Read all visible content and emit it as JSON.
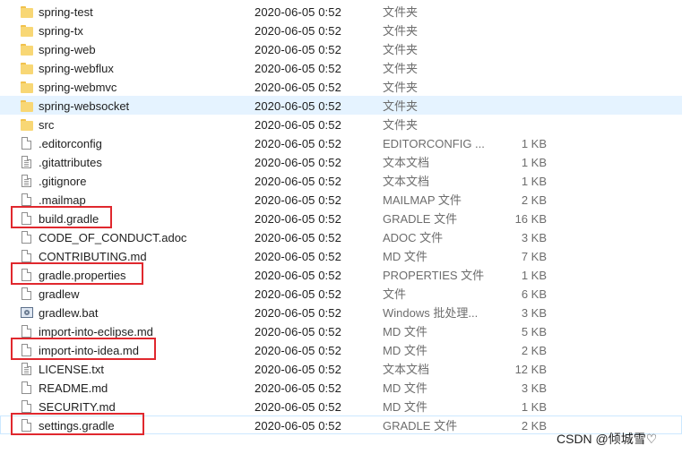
{
  "files": [
    {
      "name": "spring-test",
      "date": "2020-06-05  0:52",
      "type": "文件夹",
      "size": "",
      "icon": "folder-icon"
    },
    {
      "name": "spring-tx",
      "date": "2020-06-05  0:52",
      "type": "文件夹",
      "size": "",
      "icon": "folder-icon"
    },
    {
      "name": "spring-web",
      "date": "2020-06-05  0:52",
      "type": "文件夹",
      "size": "",
      "icon": "folder-icon"
    },
    {
      "name": "spring-webflux",
      "date": "2020-06-05  0:52",
      "type": "文件夹",
      "size": "",
      "icon": "folder-icon"
    },
    {
      "name": "spring-webmvc",
      "date": "2020-06-05  0:52",
      "type": "文件夹",
      "size": "",
      "icon": "folder-icon"
    },
    {
      "name": "spring-websocket",
      "date": "2020-06-05  0:52",
      "type": "文件夹",
      "size": "",
      "icon": "folder-icon",
      "state": "hover"
    },
    {
      "name": "src",
      "date": "2020-06-05  0:52",
      "type": "文件夹",
      "size": "",
      "icon": "folder-icon"
    },
    {
      "name": ".editorconfig",
      "date": "2020-06-05  0:52",
      "type": "EDITORCONFIG ...",
      "size": "1 KB",
      "icon": "file-icon"
    },
    {
      "name": ".gitattributes",
      "date": "2020-06-05  0:52",
      "type": "文本文档",
      "size": "1 KB",
      "icon": "text-file-icon"
    },
    {
      "name": ".gitignore",
      "date": "2020-06-05  0:52",
      "type": "文本文档",
      "size": "1 KB",
      "icon": "text-file-icon"
    },
    {
      "name": ".mailmap",
      "date": "2020-06-05  0:52",
      "type": "MAILMAP 文件",
      "size": "2 KB",
      "icon": "file-icon"
    },
    {
      "name": "build.gradle",
      "date": "2020-06-05  0:52",
      "type": "GRADLE 文件",
      "size": "16 KB",
      "icon": "file-icon",
      "highlight": true
    },
    {
      "name": "CODE_OF_CONDUCT.adoc",
      "date": "2020-06-05  0:52",
      "type": "ADOC 文件",
      "size": "3 KB",
      "icon": "file-icon"
    },
    {
      "name": "CONTRIBUTING.md",
      "date": "2020-06-05  0:52",
      "type": "MD 文件",
      "size": "7 KB",
      "icon": "file-icon"
    },
    {
      "name": "gradle.properties",
      "date": "2020-06-05  0:52",
      "type": "PROPERTIES 文件",
      "size": "1 KB",
      "icon": "file-icon",
      "highlight": true
    },
    {
      "name": "gradlew",
      "date": "2020-06-05  0:52",
      "type": "文件",
      "size": "6 KB",
      "icon": "file-icon"
    },
    {
      "name": "gradlew.bat",
      "date": "2020-06-05  0:52",
      "type": "Windows 批处理...",
      "size": "3 KB",
      "icon": "batch-file-icon"
    },
    {
      "name": "import-into-eclipse.md",
      "date": "2020-06-05  0:52",
      "type": "MD 文件",
      "size": "5 KB",
      "icon": "file-icon"
    },
    {
      "name": "import-into-idea.md",
      "date": "2020-06-05  0:52",
      "type": "MD 文件",
      "size": "2 KB",
      "icon": "file-icon",
      "highlight": true
    },
    {
      "name": "LICENSE.txt",
      "date": "2020-06-05  0:52",
      "type": "文本文档",
      "size": "12 KB",
      "icon": "text-file-icon"
    },
    {
      "name": "README.md",
      "date": "2020-06-05  0:52",
      "type": "MD 文件",
      "size": "3 KB",
      "icon": "file-icon"
    },
    {
      "name": "SECURITY.md",
      "date": "2020-06-05  0:52",
      "type": "MD 文件",
      "size": "1 KB",
      "icon": "file-icon"
    },
    {
      "name": "settings.gradle",
      "date": "2020-06-05  0:52",
      "type": "GRADLE 文件",
      "size": "2 KB",
      "icon": "file-icon",
      "highlight": true,
      "state": "outlined"
    }
  ],
  "colors": {
    "highlight": "#e0282e",
    "hover": "#e5f3ff",
    "folder": "#f8d775"
  },
  "watermark": "CSDN @倾城雪♡"
}
